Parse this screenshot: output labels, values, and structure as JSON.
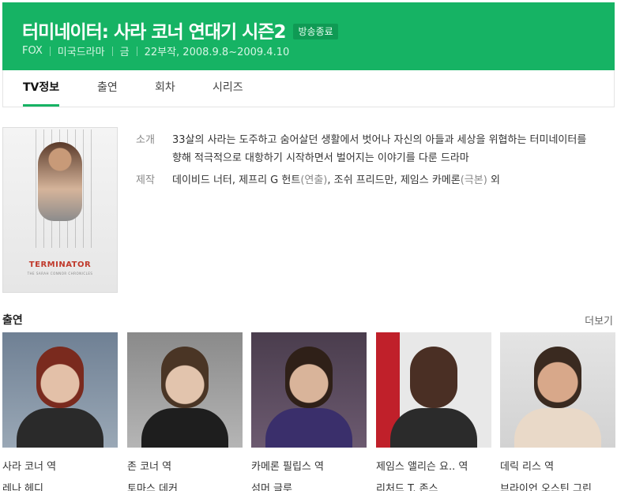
{
  "header": {
    "title": "터미네이터: 사라 코너 연대기 시즌2",
    "badge": "방송종료",
    "meta": [
      "FOX",
      "미국드라마",
      "금",
      "22부작, 2008.9.8~2009.4.10"
    ]
  },
  "tabs": [
    {
      "label": "TV정보",
      "active": true
    },
    {
      "label": "출연",
      "active": false
    },
    {
      "label": "회차",
      "active": false
    },
    {
      "label": "시리즈",
      "active": false
    }
  ],
  "poster": {
    "logo_text": "TERMINATOR",
    "subtitle_text": "THE SARAH CONNOR CHRONICLES"
  },
  "info": {
    "synopsis_label": "소개",
    "synopsis": "33살의 사라는 도주하고 숨어살던 생활에서 벗어나 자신의 아들과 세상을 위협하는 터미네이터를 향해 적극적으로 대항하기 시작하면서 벌어지는 이야기를 다룬 드라마",
    "staff_label": "제작",
    "staff": [
      {
        "name": "데이비드 너터",
        "sep": ", "
      },
      {
        "name": "제프리 G 헌트",
        "role": "(연출)",
        "sep": ", "
      },
      {
        "name": "조쉬 프리드만",
        "sep": ", "
      },
      {
        "name": "제임스 카메론",
        "role": "(극본)",
        "sep": " "
      },
      {
        "name": "외",
        "sep": ""
      }
    ]
  },
  "cast_section": {
    "title": "출연",
    "more": "더보기"
  },
  "cast": [
    {
      "role": "사라 코너 역",
      "actor": "레나 헤디"
    },
    {
      "role": "존 코너 역",
      "actor": "토마스 데커"
    },
    {
      "role": "카메론 필립스 역",
      "actor": "섬머 글루"
    },
    {
      "role": "제임스 앨리슨 요.. 역",
      "actor": "리처드 T. 존스"
    },
    {
      "role": "데릭 리스 역",
      "actor": "브라이언 오스틴 그린"
    }
  ],
  "colors": {
    "brand": "#16b364",
    "badge_bg": "#0f9a54"
  }
}
